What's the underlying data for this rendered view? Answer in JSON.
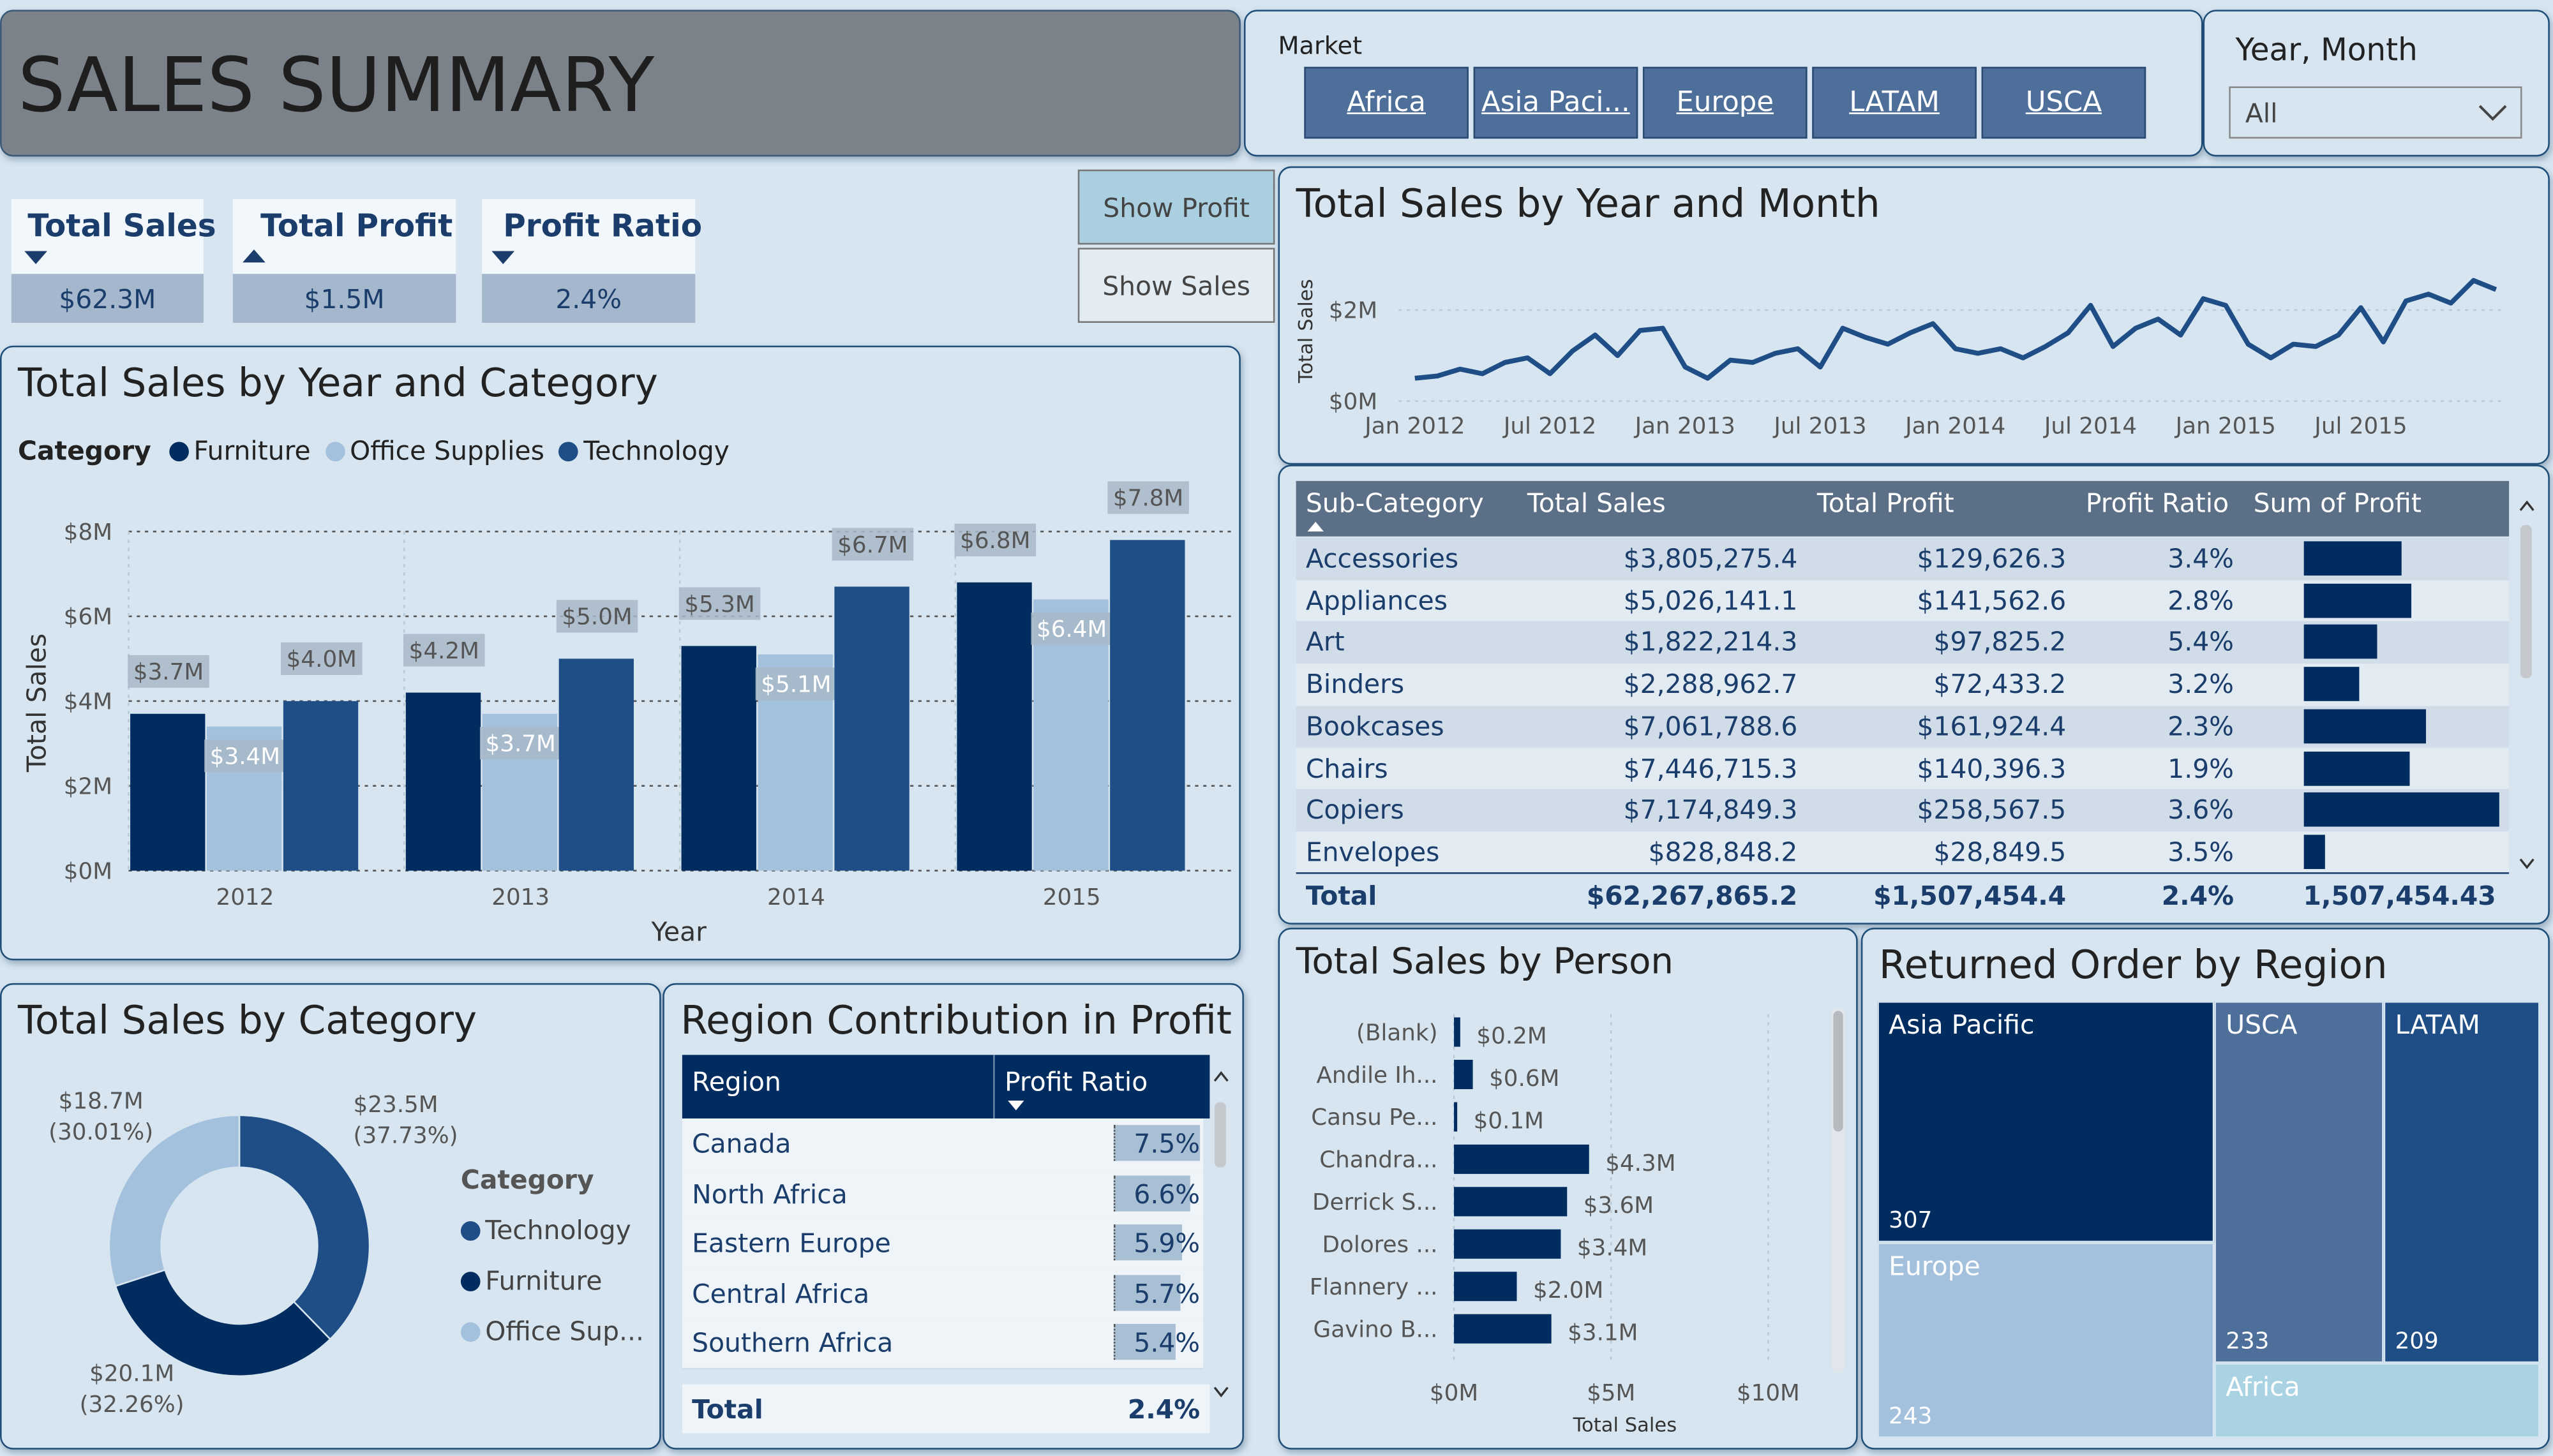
{
  "title": "SALES SUMMARY",
  "market": {
    "label": "Market",
    "buttons": [
      "Africa",
      "Asia Paci...",
      "Europe",
      "LATAM",
      "USCA"
    ]
  },
  "year_month": {
    "label": "Year, Month",
    "value": "All"
  },
  "kpis": [
    {
      "label": "Total Sales",
      "value": "$62.3M"
    },
    {
      "label": "Total Profit",
      "value": "$1.5M"
    },
    {
      "label": "Profit Ratio",
      "value": "2.4%"
    }
  ],
  "toggles": {
    "show_profit": "Show Profit",
    "show_sales": "Show Sales"
  },
  "colors": {
    "furniture": "#002c5f",
    "office": "#a3c0dd",
    "technology": "#1f4e87",
    "bg": "#d6e5f0"
  },
  "charts": {
    "year_category": {
      "title": "Total Sales by Year and Category",
      "legend_title": "Category",
      "legend": [
        "Furniture",
        "Office Supplies",
        "Technology"
      ],
      "y_ticks": [
        "$0M",
        "$2M",
        "$4M",
        "$6M",
        "$8M"
      ],
      "xlabel": "Year",
      "ylabel": "Total Sales"
    },
    "by_category": {
      "title": "Total Sales by Category",
      "legend_title": "Category",
      "legend": [
        "Technology",
        "Furniture",
        "Office Sup..."
      ]
    },
    "year_month": {
      "title": "Total Sales by Year and Month",
      "ylabel": "Total Sales",
      "y_ticks": [
        "$0M",
        "$2M"
      ],
      "x_ticks": [
        "Jan 2012",
        "Jul 2012",
        "Jan 2013",
        "Jul 2013",
        "Jan 2014",
        "Jul 2014",
        "Jan 2015",
        "Jul 2015"
      ]
    },
    "by_person": {
      "title": "Total Sales by Person",
      "x_ticks": [
        "$0M",
        "$5M",
        "$10M"
      ],
      "xlabel": "Total Sales"
    }
  },
  "chart_data": [
    {
      "type": "bar",
      "title": "Total Sales by Year and Category",
      "categories": [
        "2012",
        "2013",
        "2014",
        "2015"
      ],
      "series": [
        {
          "name": "Furniture",
          "values": [
            3.7,
            4.2,
            5.3,
            6.8
          ],
          "labels": [
            "$3.7M",
            "$4.2M",
            "$5.3M",
            "$6.8M"
          ]
        },
        {
          "name": "Office Supplies",
          "values": [
            3.4,
            3.7,
            5.1,
            6.4
          ],
          "labels": [
            "$3.4M",
            "$3.7M",
            "$5.1M",
            "$6.4M"
          ]
        },
        {
          "name": "Technology",
          "values": [
            4.0,
            5.0,
            6.7,
            7.8
          ],
          "labels": [
            "$4.0M",
            "$5.0M",
            "$6.7M",
            "$7.8M"
          ]
        }
      ],
      "xlabel": "Year",
      "ylabel": "Total Sales",
      "ylim": [
        0,
        8
      ],
      "legend": "top-left"
    },
    {
      "type": "pie",
      "title": "Total Sales by Category",
      "slices": [
        {
          "name": "Technology",
          "value": 23.5,
          "label": "$23.5M",
          "pct": "(37.73%)"
        },
        {
          "name": "Furniture",
          "value": 20.1,
          "label": "$20.1M",
          "pct": "(32.26%)"
        },
        {
          "name": "Office Sup...",
          "value": 18.7,
          "label": "$18.7M",
          "pct": "(30.01%)"
        }
      ],
      "legend": "right"
    },
    {
      "type": "line",
      "title": "Total Sales by Year and Month",
      "ylabel": "Total Sales",
      "ylim": [
        0,
        2.9
      ],
      "x": [
        "2012-01",
        "2012-02",
        "2012-03",
        "2012-04",
        "2012-05",
        "2012-06",
        "2012-07",
        "2012-08",
        "2012-09",
        "2012-10",
        "2012-11",
        "2012-12",
        "2013-01",
        "2013-02",
        "2013-03",
        "2013-04",
        "2013-05",
        "2013-06",
        "2013-07",
        "2013-08",
        "2013-09",
        "2013-10",
        "2013-11",
        "2013-12",
        "2014-01",
        "2014-02",
        "2014-03",
        "2014-04",
        "2014-05",
        "2014-06",
        "2014-07",
        "2014-08",
        "2014-09",
        "2014-10",
        "2014-11",
        "2014-12",
        "2015-01",
        "2015-02",
        "2015-03",
        "2015-04",
        "2015-05",
        "2015-06",
        "2015-07",
        "2015-08",
        "2015-09",
        "2015-10",
        "2015-11",
        "2015-12"
      ],
      "values": [
        0.5,
        0.55,
        0.7,
        0.6,
        0.85,
        0.95,
        0.6,
        1.1,
        1.45,
        1.0,
        1.55,
        1.6,
        0.75,
        0.5,
        0.9,
        0.85,
        1.05,
        1.15,
        0.75,
        1.6,
        1.4,
        1.25,
        1.5,
        1.7,
        1.15,
        1.05,
        1.15,
        0.95,
        1.2,
        1.5,
        2.1,
        1.2,
        1.6,
        1.8,
        1.45,
        2.25,
        2.1,
        1.25,
        0.95,
        1.25,
        1.2,
        1.45,
        2.05,
        1.3,
        2.2,
        2.35,
        2.15,
        2.65,
        2.45
      ]
    },
    {
      "type": "table",
      "columns": [
        "Sub-Category",
        "Total Sales",
        "Total Profit",
        "Profit Ratio",
        "Sum of Profit"
      ],
      "rows": [
        [
          "Accessories",
          "$3,805,275.4",
          "$129,626.3",
          "3.4%",
          129626.3
        ],
        [
          "Appliances",
          "$5,026,141.1",
          "$141,562.6",
          "2.8%",
          141562.6
        ],
        [
          "Art",
          "$1,822,214.3",
          "$97,825.2",
          "5.4%",
          97825.2
        ],
        [
          "Binders",
          "$2,288,962.7",
          "$72,433.2",
          "3.2%",
          72433.2
        ],
        [
          "Bookcases",
          "$7,061,788.6",
          "$161,924.4",
          "2.3%",
          161924.4
        ],
        [
          "Chairs",
          "$7,446,715.3",
          "$140,396.3",
          "1.9%",
          140396.3
        ],
        [
          "Copiers",
          "$7,174,849.3",
          "$258,567.5",
          "3.6%",
          258567.5
        ],
        [
          "Envelopes",
          "$828,848.2",
          "$28,849.5",
          "3.5%",
          28849.5
        ]
      ],
      "total": [
        "Total",
        "$62,267,865.2",
        "$1,507,454.4",
        "2.4%",
        "1,507,454.43"
      ]
    },
    {
      "type": "table",
      "title": "Region Contribution in Profit",
      "columns": [
        "Region",
        "Profit Ratio"
      ],
      "rows": [
        [
          "Canada",
          "7.5%",
          7.5
        ],
        [
          "North Africa",
          "6.6%",
          6.6
        ],
        [
          "Eastern Europe",
          "5.9%",
          5.9
        ],
        [
          "Central Africa",
          "5.7%",
          5.7
        ],
        [
          "Southern Africa",
          "5.4%",
          5.4
        ]
      ],
      "total": [
        "Total",
        "2.4%"
      ]
    },
    {
      "type": "bar",
      "orientation": "horizontal",
      "title": "Total Sales by Person",
      "categories": [
        "(Blank)",
        "Andile Ih...",
        "Cansu Pe...",
        "Chandra...",
        "Derrick S...",
        "Dolores ...",
        "Flannery ...",
        "Gavino B..."
      ],
      "values": [
        0.2,
        0.6,
        0.1,
        4.3,
        3.6,
        3.4,
        2.0,
        3.1
      ],
      "labels": [
        "$0.2M",
        "$0.6M",
        "$0.1M",
        "$4.3M",
        "$3.6M",
        "$3.4M",
        "$2.0M",
        "$3.1M"
      ],
      "xlabel": "Total Sales",
      "xlim": [
        0,
        10
      ]
    },
    {
      "type": "treemap",
      "title": "Returned Order by Region",
      "items": [
        {
          "name": "Asia Pacific",
          "value": 307
        },
        {
          "name": "USCA",
          "value": 233
        },
        {
          "name": "LATAM",
          "value": 209
        },
        {
          "name": "Europe",
          "value": 243
        },
        {
          "name": "Africa",
          "value": ""
        }
      ]
    }
  ],
  "region_table": {
    "title": "Region Contribution in Profit",
    "col_region": "Region",
    "col_ratio": "Profit Ratio",
    "total_label": "Total",
    "total_value": "2.4%"
  },
  "treemap": {
    "title": "Returned Order by Region"
  }
}
